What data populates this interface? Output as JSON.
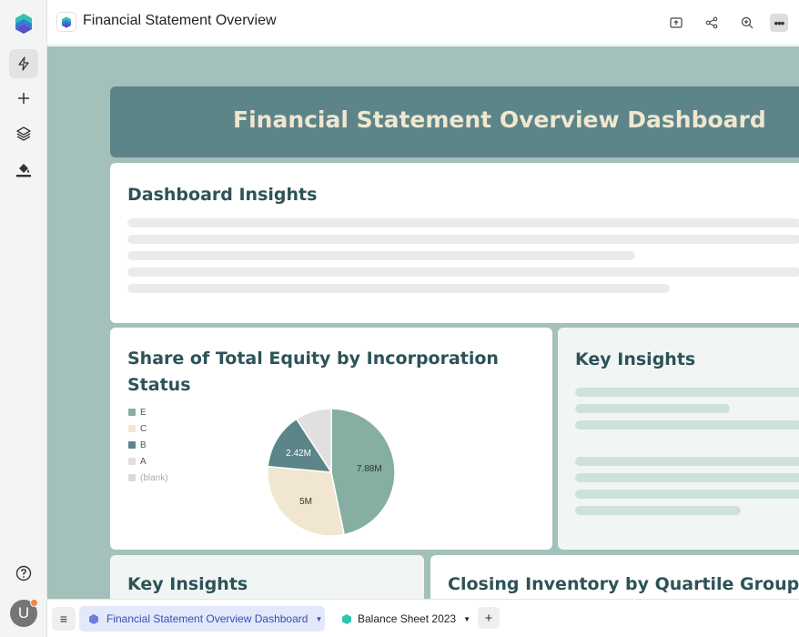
{
  "topbar": {
    "title": "Financial Statement Overview",
    "actions": [
      "export-icon",
      "share-icon",
      "zoom-in-icon",
      "more-icon"
    ],
    "more_label": "•••"
  },
  "rail": {
    "items": [
      "lightning-icon",
      "plus-icon",
      "layers-icon",
      "paint-bucket-icon"
    ],
    "avatar_initial": "U"
  },
  "dashboard": {
    "title": "Financial Statement Overview Dashboard",
    "insights_title": "Dashboard Insights",
    "pie_title": "Share of Total Equity by Incorporation Status",
    "key_insights_title": "Key Insights",
    "key_insights_title_2": "Key Insights",
    "inventory_title": "Closing Inventory by Quartile Group"
  },
  "chart_data": {
    "type": "pie",
    "title": "Share of Total Equity by Incorporation Status",
    "legend": [
      "E",
      "C",
      "B",
      "A",
      "(blank)"
    ],
    "slices": [
      {
        "label": "E",
        "value": 7.88,
        "display": "7.88M",
        "color": "#86aea2"
      },
      {
        "label": "C",
        "value": 5.0,
        "display": "5M",
        "color": "#f1e6cf"
      },
      {
        "label": "B",
        "value": 2.42,
        "display": "2.42M",
        "color": "#5b8589"
      },
      {
        "label": "A",
        "value": 1.55,
        "display": "",
        "color": "#e0e0e0"
      },
      {
        "label": "(blank)",
        "value": 0,
        "display": "",
        "color": "#d9d9d9"
      }
    ],
    "legend_position": "left"
  },
  "tabs": [
    {
      "label": "Financial Statement Overview Dashboard",
      "active": true,
      "color": "#6c7de0"
    },
    {
      "label": "Balance Sheet 2023",
      "active": false,
      "color": "#2ec4b0"
    }
  ],
  "tabbar": {
    "menu_label": "≡",
    "add_label": "+",
    "caret": "▼"
  }
}
